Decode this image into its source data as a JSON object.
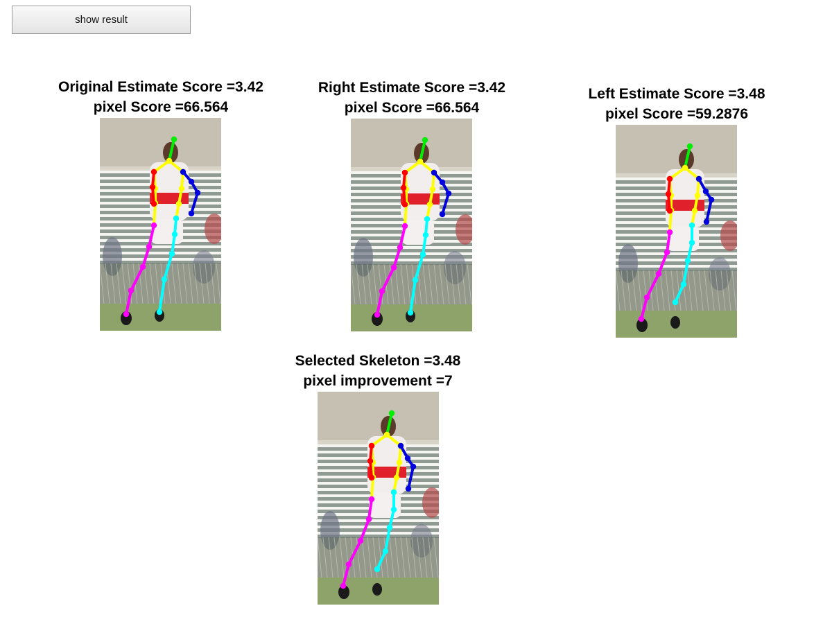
{
  "toolbar": {
    "show_result_label": "show result"
  },
  "panels": [
    {
      "id": "original",
      "title_line1": "Original Estimate Score =3.42",
      "title_line2": "pixel Score =66.564"
    },
    {
      "id": "right",
      "title_line1": "Right Estimate Score =3.42",
      "title_line2": "pixel Score =66.564"
    },
    {
      "id": "left",
      "title_line1": "Left Estimate Score =3.48",
      "title_line2": "pixel Score =59.2876"
    },
    {
      "id": "selected",
      "title_line1": "Selected Skeleton =3.48",
      "title_line2": "pixel improvement =7"
    }
  ],
  "skeleton_colors": {
    "head": "#00ee00",
    "torso": "#ffff00",
    "right_arm": "#ff0000",
    "left_arm": "#0000dd",
    "right_leg": "#ff00ff",
    "left_leg": "#00ffff"
  }
}
